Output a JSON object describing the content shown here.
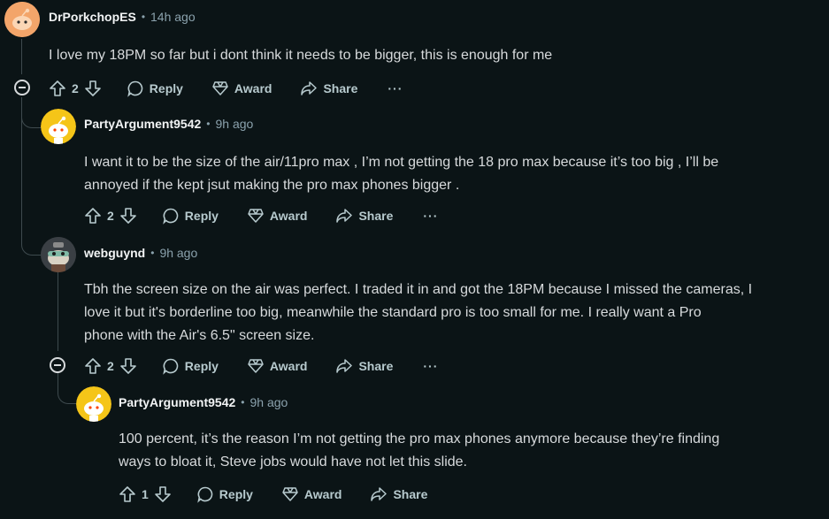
{
  "icons": {
    "upvote": "arrow-up-icon",
    "downvote": "arrow-down-icon",
    "reply": "comment-bubble-icon",
    "award": "award-icon",
    "share": "share-icon",
    "more": "ellipsis-icon",
    "collapse": "minus-circle-icon"
  },
  "colors": {
    "background": "#0b1416",
    "username": "#f2f4f5",
    "text": "#d7dadc",
    "muted": "#8ba2ad",
    "thread_line": "#3e4a4e",
    "snoo_yellow": "#f5c518",
    "snoo_orange": "#f3a56a"
  },
  "comments": [
    {
      "username": "DrPorkchopES",
      "sep": "•",
      "time": "14h ago",
      "text": "I love my 18PM so far but i dont think it needs to be bigger, this is enough for me",
      "votes": "2",
      "reply": "Reply",
      "award": "Award",
      "share": "Share",
      "more": "···"
    },
    {
      "username": "PartyArgument9542",
      "sep": "•",
      "time": "9h ago",
      "text_lines": [
        "I want it to be the size of the air/11pro max , I’m not getting the 18 pro max because it’s too big , I’ll be",
        "annoyed if the kept jsut making the pro max phones bigger ."
      ],
      "votes": "2",
      "reply": "Reply",
      "award": "Award",
      "share": "Share",
      "more": "···"
    },
    {
      "username": "webguynd",
      "sep": "•",
      "time": "9h ago",
      "text_lines": [
        "Tbh the screen size on the air was perfect. I traded it in and got the 18PM because I missed the cameras, I",
        "love it but it's borderline too big, meanwhile the standard pro is too small for me. I really want a Pro",
        "phone with the Air's 6.5\" screen size."
      ],
      "votes": "2",
      "reply": "Reply",
      "award": "Award",
      "share": "Share",
      "more": "···"
    },
    {
      "username": "PartyArgument9542",
      "sep": "•",
      "time": "9h ago",
      "text_lines": [
        "100 percent, it’s the reason I’m not getting the pro max phones anymore because they’re finding",
        "ways to bloat it, Steve jobs would have not let this slide."
      ],
      "votes": "1",
      "reply": "Reply",
      "award": "Award",
      "share": "Share",
      "more": "···"
    }
  ]
}
